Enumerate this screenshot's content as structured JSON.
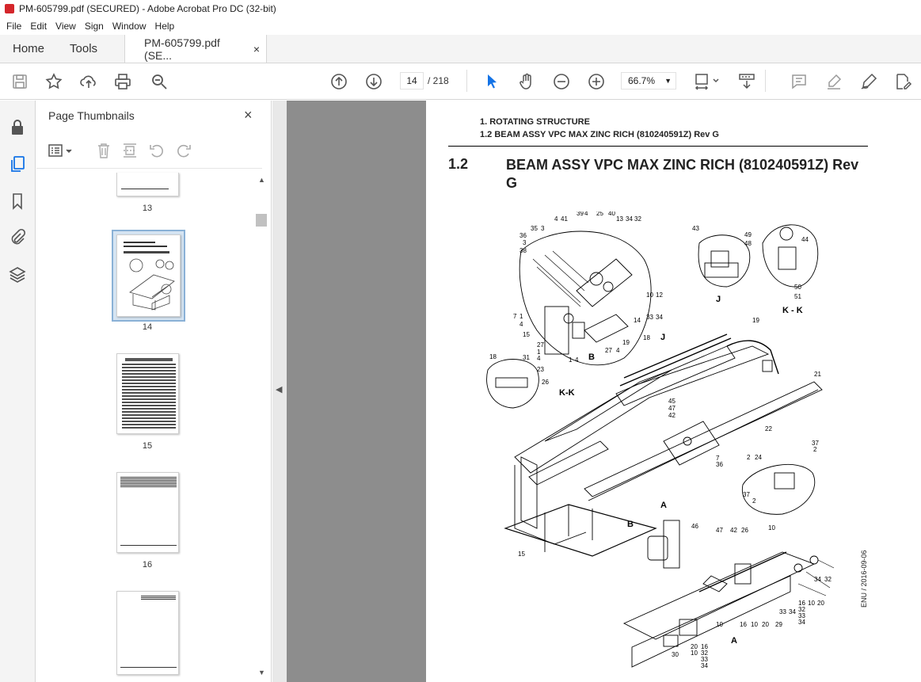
{
  "window": {
    "title": "PM-605799.pdf (SECURED) - Adobe Acrobat Pro DC (32-bit)"
  },
  "menu": [
    "File",
    "Edit",
    "View",
    "Sign",
    "Window",
    "Help"
  ],
  "tabs": {
    "home": "Home",
    "tools": "Tools",
    "doc": "PM-605799.pdf (SE...",
    "close": "×"
  },
  "toolbar": {
    "page_current": "14",
    "page_total": "/ 218",
    "zoom": "66.7%"
  },
  "thumbnails": {
    "title": "Page Thumbnails",
    "close": "×",
    "pages": [
      {
        "label": "13"
      },
      {
        "label": "14"
      },
      {
        "label": "15"
      },
      {
        "label": "16"
      }
    ]
  },
  "document": {
    "header_line1": "1. ROTATING STRUCTURE",
    "header_line2": "1.2 BEAM ASSY VPC MAX ZINC RICH (810240591Z) Rev G",
    "section_number": "1.2",
    "section_title": "BEAM ASSY VPC MAX ZINC RICH (810240591Z) Rev G",
    "side_note": "ENU / 2016-09-06",
    "view_labels": [
      "J",
      "K - K",
      "K-K",
      "B",
      "A",
      "J",
      "B",
      "A"
    ],
    "callouts": [
      "4",
      "41",
      "39",
      "4",
      "25",
      "40",
      "13",
      "34",
      "32",
      "35",
      "3",
      "36",
      "3",
      "38",
      "43",
      "49",
      "48",
      "44",
      "50",
      "51",
      "10",
      "12",
      "33",
      "34",
      "14",
      "7",
      "1",
      "4",
      "15",
      "27",
      "1",
      "4",
      "19",
      "27",
      "4",
      "1",
      "4",
      "18",
      "19",
      "18",
      "31",
      "23",
      "26",
      "21",
      "45",
      "47",
      "42",
      "37",
      "2",
      "22",
      "7",
      "36",
      "2",
      "24",
      "37",
      "2",
      "15",
      "46",
      "47",
      "42",
      "26",
      "10",
      "34",
      "32",
      "16",
      "10",
      "20",
      "33",
      "34",
      "16",
      "32",
      "33",
      "34",
      "10",
      "16",
      "10",
      "20",
      "29",
      "20",
      "16",
      "10",
      "32",
      "33",
      "34",
      "30"
    ]
  }
}
